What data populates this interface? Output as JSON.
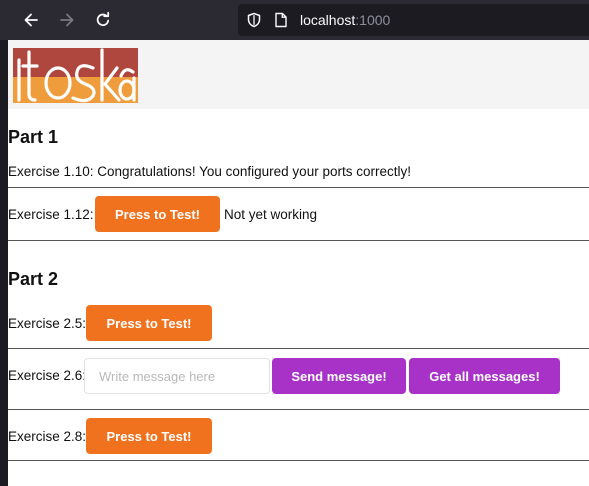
{
  "browser": {
    "url_host": "localhost",
    "url_port": ":1000",
    "icons": [
      "back-arrow-icon",
      "forward-arrow-icon",
      "reload-icon",
      "shield-icon",
      "page-icon"
    ]
  },
  "header": {
    "logo_text": "itoska",
    "logo_colors": {
      "red": "#b0473f",
      "orange": "#ee9c3c"
    }
  },
  "part1": {
    "title": "Part 1",
    "exercise_110": "Exercise 1.10: Congratulations! You configured your ports correctly!",
    "exercise_112_label": "Exercise 1.12:",
    "exercise_112_button": "Press to Test!",
    "exercise_112_status": "Not yet working"
  },
  "part2": {
    "title": "Part 2",
    "exercise_25_label": "Exercise 2.5:",
    "exercise_25_button": "Press to Test!",
    "exercise_26_label": "Exercise 2.6:",
    "exercise_26_placeholder": "Write message here",
    "exercise_26_value": "",
    "send_button": "Send message!",
    "get_all_button": "Get all messages!",
    "exercise_28_label": "Exercise 2.8:",
    "exercise_28_button": "Press to Test!"
  },
  "colors": {
    "orange_button": "#f0721f",
    "purple_button": "#a832c7",
    "toolbar": "#2b2a33",
    "urlbar": "#1c1b22"
  }
}
